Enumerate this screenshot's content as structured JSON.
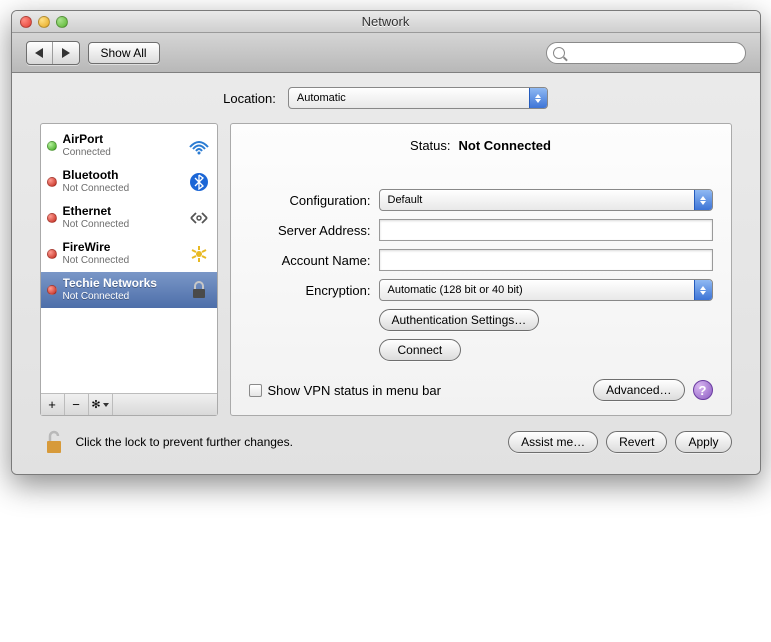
{
  "title": "Network",
  "toolbar": {
    "show_all": "Show All"
  },
  "location": {
    "label": "Location:",
    "value": "Automatic"
  },
  "sidebar": {
    "items": [
      {
        "name": "AirPort",
        "sub": "Connected",
        "status": "green",
        "icon": "wifi"
      },
      {
        "name": "Bluetooth",
        "sub": "Not Connected",
        "status": "red",
        "icon": "bluetooth"
      },
      {
        "name": "Ethernet",
        "sub": "Not Connected",
        "status": "red",
        "icon": "ethernet"
      },
      {
        "name": "FireWire",
        "sub": "Not Connected",
        "status": "red",
        "icon": "firewire"
      },
      {
        "name": "Techie Networks",
        "sub": "Not Connected",
        "status": "red",
        "icon": "lock",
        "selected": true
      }
    ]
  },
  "main": {
    "status_label": "Status:",
    "status_value": "Not Connected",
    "config_label": "Configuration:",
    "config_value": "Default",
    "server_label": "Server Address:",
    "server_value": "",
    "account_label": "Account Name:",
    "account_value": "",
    "encryption_label": "Encryption:",
    "encryption_value": "Automatic (128 bit or 40 bit)",
    "auth_button": "Authentication Settings…",
    "connect_button": "Connect",
    "show_vpn": "Show VPN status in menu bar",
    "advanced": "Advanced…"
  },
  "bottom": {
    "lock_text": "Click the lock to prevent further changes.",
    "assist": "Assist me…",
    "revert": "Revert",
    "apply": "Apply"
  }
}
